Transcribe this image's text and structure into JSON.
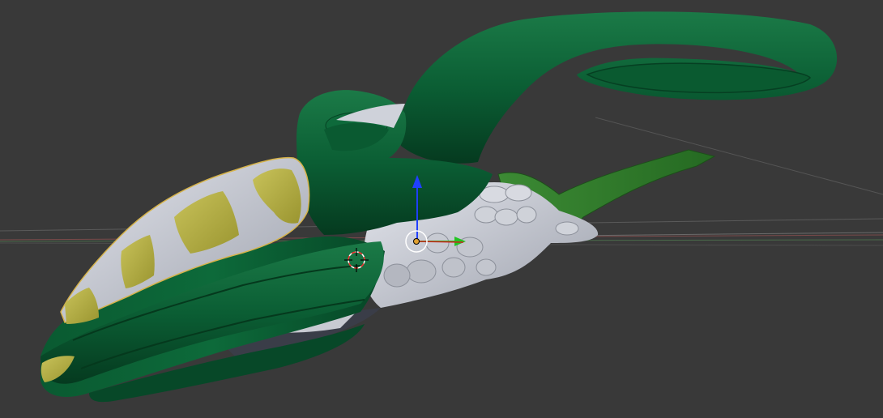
{
  "viewport": {
    "colors": {
      "background": "#393939",
      "hull_green": "#0b5e34",
      "hull_green_dark": "#064223",
      "hull_green_light": "#1b7a47",
      "panel_white": "#c9ccd6",
      "window_yellow": "#b5b043",
      "thruster_grey": "#b9bcc4",
      "fin_green": "#2f7a2a",
      "axis_x": "#b04a4a",
      "axis_y": "#5a9a3a",
      "gizmo_blue": "#2040ff",
      "gizmo_green": "#22c422",
      "gizmo_red": "#d22020",
      "origin_orange": "#e0a030"
    },
    "icons": [
      "3d-cursor-icon",
      "transform-gizmo-icon",
      "object-origin-icon"
    ]
  }
}
